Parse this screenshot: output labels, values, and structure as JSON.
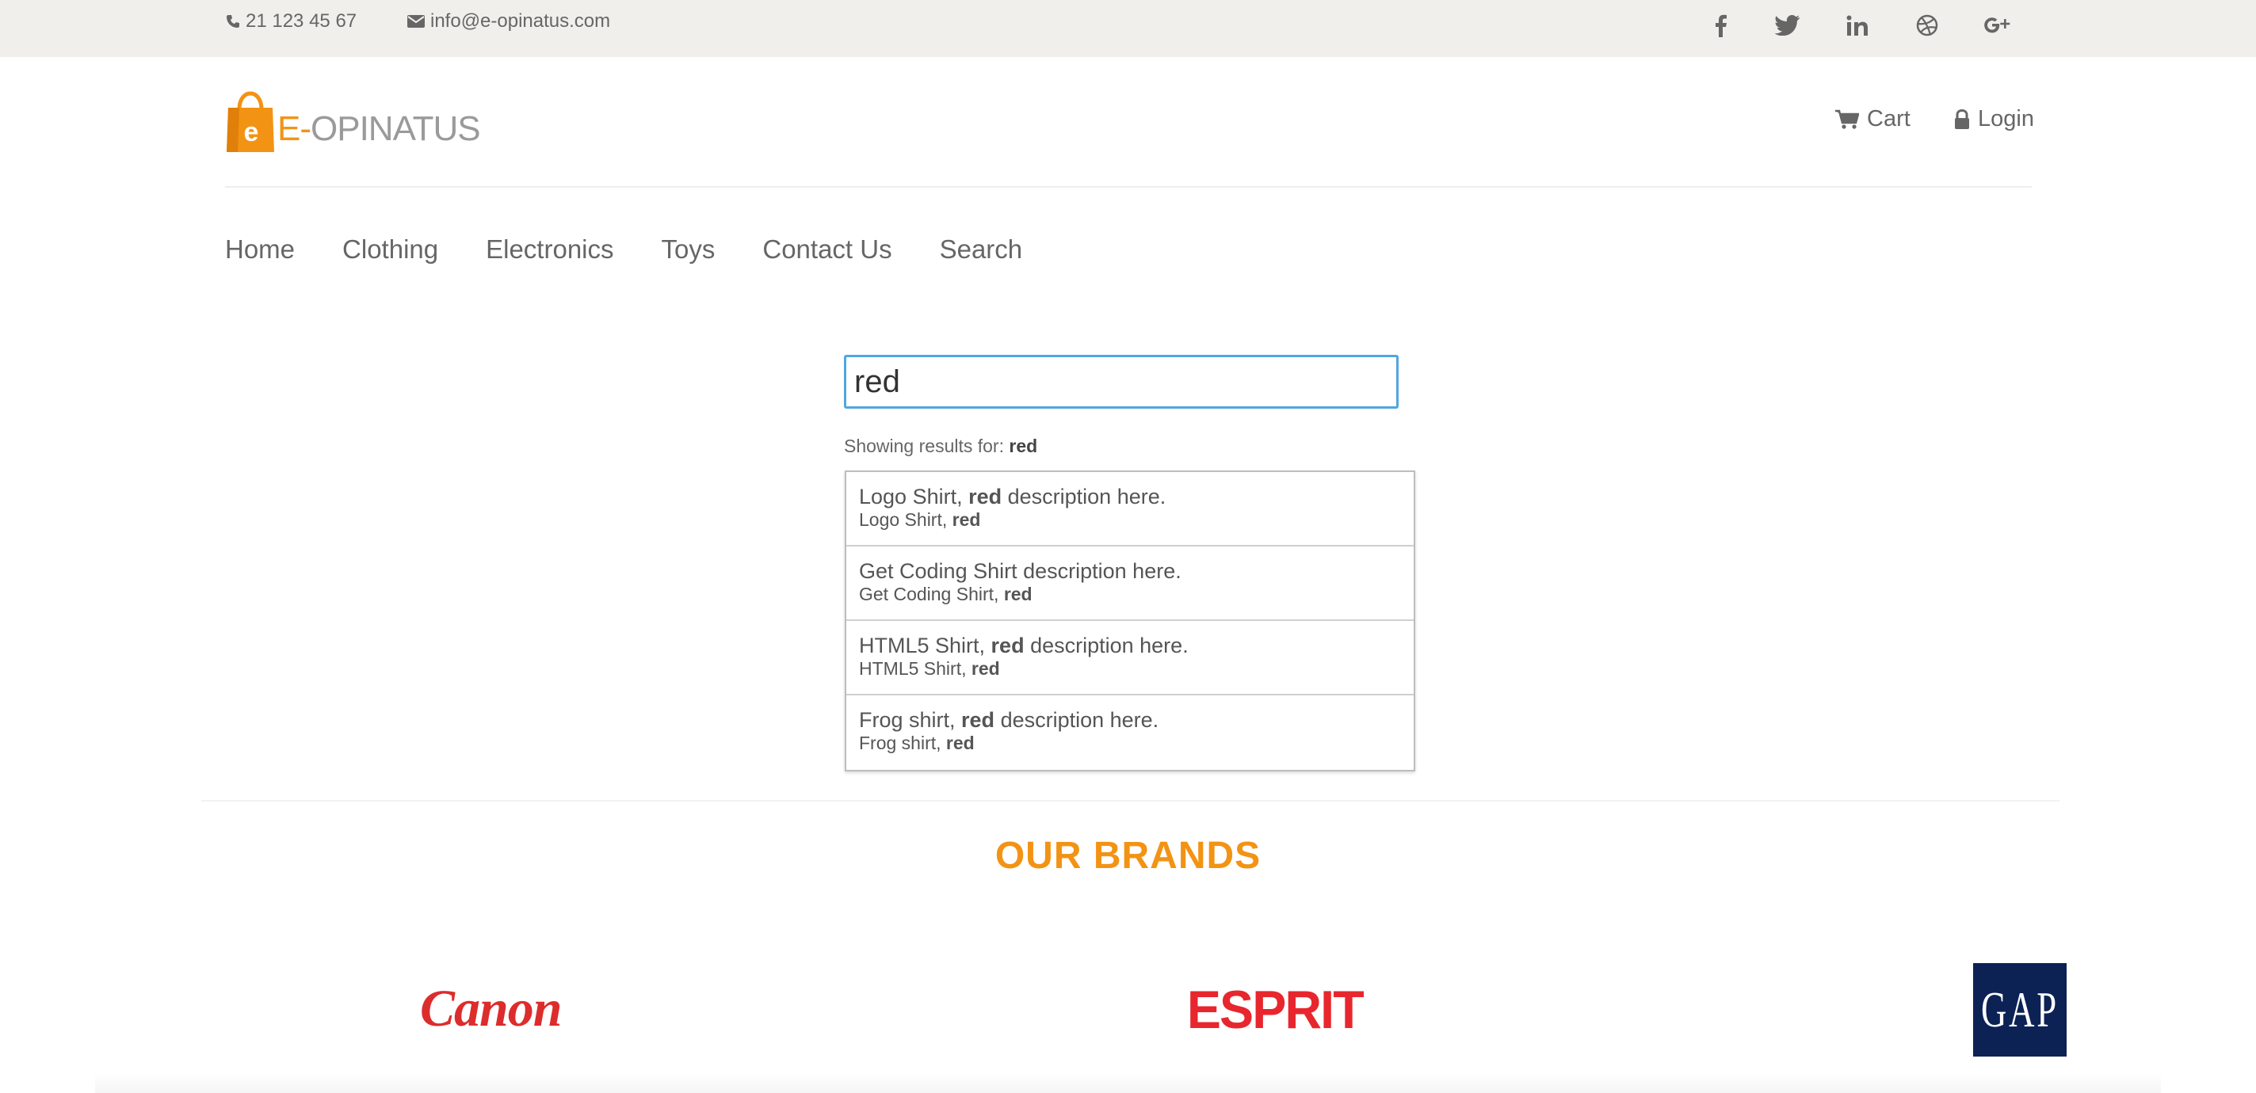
{
  "topbar": {
    "phone": "21 123 45 67",
    "email": "info@e-opinatus.com",
    "social": [
      "facebook-icon",
      "twitter-icon",
      "linkedin-icon",
      "dribbble-icon",
      "google-plus-icon"
    ]
  },
  "header": {
    "logo_badge": "e",
    "logo_text_prefix": "E-",
    "logo_text_rest": "OPINATUS",
    "cart_label": "Cart",
    "login_label": "Login"
  },
  "nav": {
    "items": [
      "Home",
      "Clothing",
      "Electronics",
      "Toys",
      "Contact Us",
      "Search"
    ]
  },
  "search": {
    "value": "red",
    "results_prefix": "Showing results for:",
    "results_term": "red",
    "results": [
      {
        "title_pre": "Logo Shirt, ",
        "title_bold": "red",
        "title_post": " description here.",
        "sub_pre": "Logo Shirt, ",
        "sub_bold": "red"
      },
      {
        "title_pre": "Get Coding Shirt description here.",
        "title_bold": "",
        "title_post": "",
        "sub_pre": "Get Coding Shirt, ",
        "sub_bold": "red"
      },
      {
        "title_pre": "HTML5 Shirt, ",
        "title_bold": "red",
        "title_post": " description here.",
        "sub_pre": "HTML5 Shirt, ",
        "sub_bold": "red"
      },
      {
        "title_pre": "Frog shirt, ",
        "title_bold": "red",
        "title_post": " description here.",
        "sub_pre": "Frog shirt, ",
        "sub_bold": "red"
      }
    ]
  },
  "brands": {
    "title": "OUR BRANDS",
    "items": [
      "Canon",
      "ESPRIT",
      "GAP"
    ]
  },
  "colors": {
    "accent": "#f39313",
    "topbar_bg": "#f0efeb",
    "input_focus": "#4fa7e0",
    "canon_red": "#dd2c2c",
    "esprit_red": "#e8262d",
    "gap_navy": "#0c2255"
  }
}
